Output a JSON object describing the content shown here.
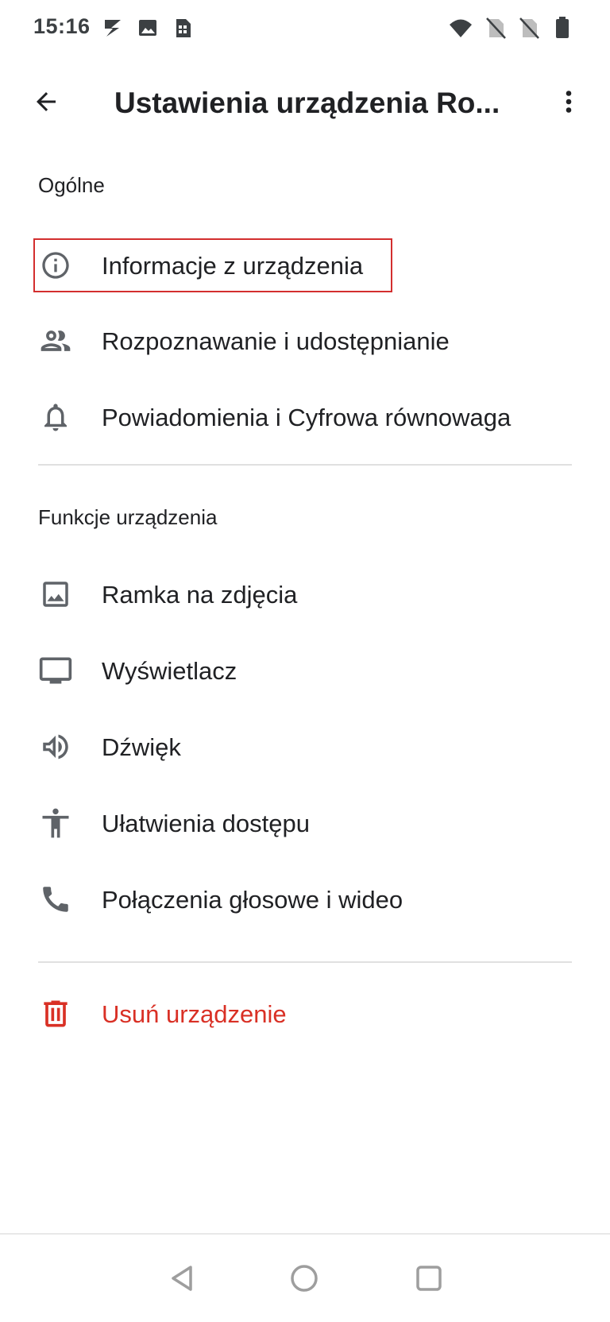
{
  "status_bar": {
    "time": "15:16",
    "left_icons": [
      "s-app-icon",
      "image-icon",
      "sim-toolkit-icon"
    ],
    "right_icons": [
      "wifi-icon",
      "no-sim-icon",
      "no-sim-icon",
      "battery-icon"
    ]
  },
  "app_bar": {
    "title": "Ustawienia urządzenia Ro..."
  },
  "sections": [
    {
      "header": "Ogólne",
      "items": [
        {
          "label": "Informacje z urządzenia",
          "icon": "info-icon"
        },
        {
          "label": "Rozpoznawanie i udostępnianie",
          "icon": "people-icon"
        },
        {
          "label": "Powiadomienia i Cyfrowa równowaga",
          "icon": "bell-icon"
        }
      ]
    },
    {
      "header": "Funkcje urządzenia",
      "items": [
        {
          "label": "Ramka na zdjęcia",
          "icon": "photo-frame-icon"
        },
        {
          "label": "Wyświetlacz",
          "icon": "display-icon"
        },
        {
          "label": "Dźwięk",
          "icon": "speaker-icon"
        },
        {
          "label": "Ułatwienia dostępu",
          "icon": "accessibility-icon"
        },
        {
          "label": "Połączenia głosowe i wideo",
          "icon": "phone-icon"
        }
      ]
    }
  ],
  "remove_device": {
    "label": "Usuń urządzenie",
    "icon": "trash-icon"
  },
  "colors": {
    "danger": "#d93025",
    "highlight": "#d32f2f",
    "icon": "#5f6368",
    "text": "#202124"
  },
  "nav_bar": {
    "buttons": [
      "back-nav-icon",
      "home-nav-icon",
      "recents-nav-icon"
    ]
  }
}
